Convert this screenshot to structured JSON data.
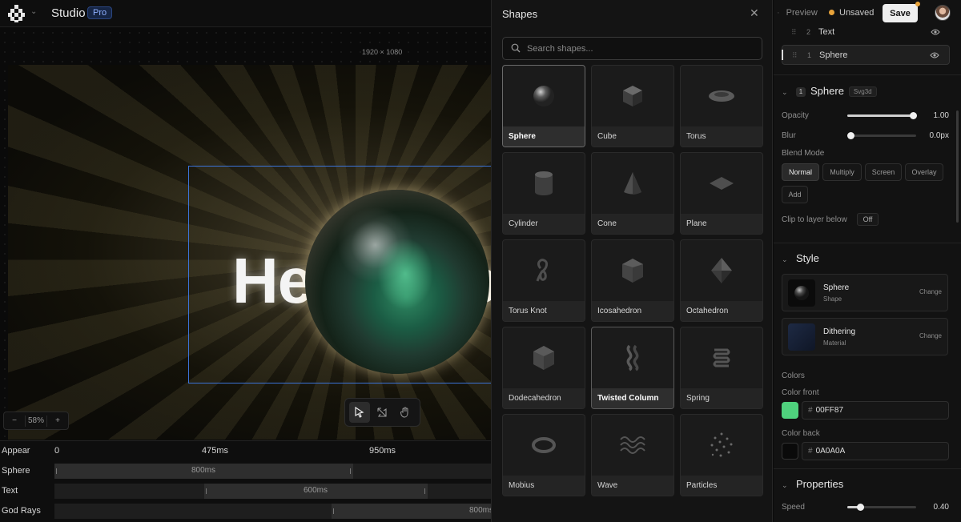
{
  "app": {
    "title": "Studio",
    "plan_badge": "Pro"
  },
  "canvas": {
    "resolution_label": "1920 × 1080",
    "text_layer_content": "Hello World",
    "zoom": {
      "minus": "−",
      "value": "58%",
      "plus": "+"
    },
    "tools": [
      "select-tool",
      "transform-tool",
      "hand-tool"
    ]
  },
  "timeline": {
    "header_label": "Appear",
    "ticks": [
      "0",
      "475ms",
      "950ms"
    ],
    "rows": [
      {
        "label": "Sphere",
        "duration": "800ms"
      },
      {
        "label": "Text",
        "duration": "600ms"
      },
      {
        "label": "God Rays",
        "duration": "800ms"
      }
    ]
  },
  "shapes_panel": {
    "title": "Shapes",
    "search_placeholder": "Search shapes...",
    "shapes": [
      {
        "label": "Sphere",
        "icon": "sphere-icon",
        "selected": true
      },
      {
        "label": "Cube",
        "icon": "cube-icon"
      },
      {
        "label": "Torus",
        "icon": "torus-icon"
      },
      {
        "label": "Cylinder",
        "icon": "cylinder-icon"
      },
      {
        "label": "Cone",
        "icon": "cone-icon"
      },
      {
        "label": "Plane",
        "icon": "plane-icon"
      },
      {
        "label": "Torus Knot",
        "icon": "torus-knot-icon"
      },
      {
        "label": "Icosahedron",
        "icon": "icosahedron-icon"
      },
      {
        "label": "Octahedron",
        "icon": "octahedron-icon"
      },
      {
        "label": "Dodecahedron",
        "icon": "dodecahedron-icon"
      },
      {
        "label": "Twisted Column",
        "icon": "twisted-column-icon",
        "highlighted": true
      },
      {
        "label": "Spring",
        "icon": "spring-icon"
      },
      {
        "label": "Mobius",
        "icon": "mobius-icon"
      },
      {
        "label": "Wave",
        "icon": "wave-icon"
      },
      {
        "label": "Particles",
        "icon": "particles-icon"
      }
    ]
  },
  "header_actions": {
    "preview_label": "Preview",
    "status_label": "Unsaved",
    "status_color": "#e8a33a",
    "save_label": "Save"
  },
  "layers": [
    {
      "index": "2",
      "name": "Text"
    },
    {
      "index": "1",
      "name": "Sphere",
      "selected": true
    }
  ],
  "layer_props": {
    "index": "1",
    "title": "Sphere",
    "type_tag": "Svg3d",
    "opacity": {
      "label": "Opacity",
      "value": "1.00",
      "level": 1.0
    },
    "blur": {
      "label": "Blur",
      "value": "0.0px",
      "level": 0.0
    },
    "blend_mode_label": "Blend Mode",
    "blend_modes": [
      "Normal",
      "Multiply",
      "Screen",
      "Overlay",
      "Add"
    ],
    "blend_active": "Normal",
    "clip_label": "Clip to layer below",
    "clip_value": "Off"
  },
  "style": {
    "title": "Style",
    "shape_card": {
      "name": "Sphere",
      "kind": "Shape",
      "action": "Change"
    },
    "material_card": {
      "name": "Dithering",
      "kind": "Material",
      "action": "Change"
    },
    "colors_label": "Colors",
    "color_front": {
      "label": "Color front",
      "hex": "00FF87",
      "swatch": "#4fd17d"
    },
    "color_back": {
      "label": "Color back",
      "hex": "0A0A0A",
      "swatch": "#0a0a0a"
    }
  },
  "properties": {
    "title": "Properties",
    "speed": {
      "label": "Speed",
      "value": "0.40",
      "level": 0.18
    }
  }
}
